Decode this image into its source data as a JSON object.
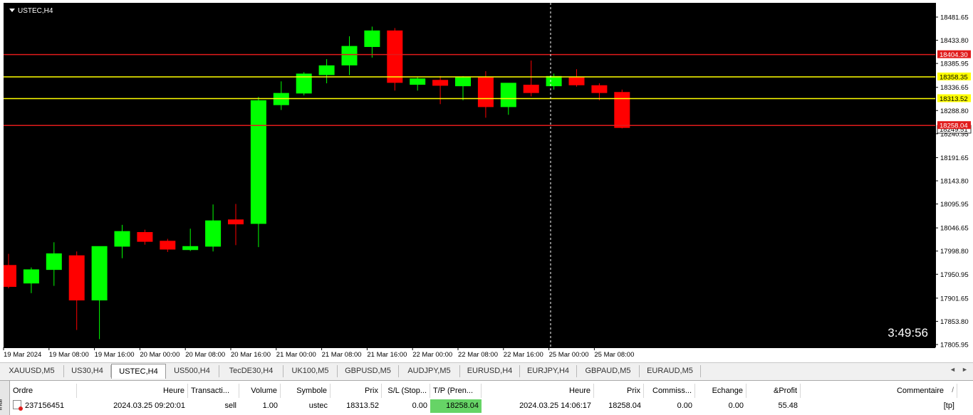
{
  "chart": {
    "symbol": "USTEC,H4",
    "countdown": "3:49:56",
    "background": "#000000",
    "bull_color": "#00ff00",
    "bear_color": "#ff0000",
    "price_ticks": [
      "18481.65",
      "18433.80",
      "18385.95",
      "18336.65",
      "18288.80",
      "18240.95",
      "18191.65",
      "18143.80",
      "18095.95",
      "18046.65",
      "17998.80",
      "17950.95",
      "17901.65",
      "17853.80",
      "17805.95"
    ],
    "time_ticks": [
      "19 Mar 2024",
      "19 Mar 08:00",
      "19 Mar 16:00",
      "20 Mar 00:00",
      "20 Mar 08:00",
      "20 Mar 16:00",
      "21 Mar 00:00",
      "21 Mar 08:00",
      "21 Mar 16:00",
      "22 Mar 00:00",
      "22 Mar 08:00",
      "22 Mar 16:00",
      "25 Mar 00:00",
      "25 Mar 08:00"
    ],
    "hlines": [
      {
        "price": 18404.3,
        "label": "18404.30",
        "color": "#e11b1b",
        "text_color": "#ffffff"
      },
      {
        "price": 18358.35,
        "label": "18358.35",
        "color": "#ffff00",
        "text_color": "#000000"
      },
      {
        "price": 18313.52,
        "label": "18313.52",
        "color": "#ffff00",
        "text_color": "#000000"
      },
      {
        "price": 18258.04,
        "label": "18258.04",
        "color": "#e11b1b",
        "text_color": "#ffffff"
      }
    ],
    "current_price": "18249.51",
    "candles": [
      {
        "o": 17970,
        "h": 17993,
        "l": 17922,
        "c": 17925
      },
      {
        "o": 17932,
        "h": 17965,
        "l": 17912,
        "c": 17961
      },
      {
        "o": 17960,
        "h": 18017,
        "l": 17927,
        "c": 17994
      },
      {
        "o": 17990,
        "h": 17998,
        "l": 17836,
        "c": 17897
      },
      {
        "o": 17897,
        "h": 18001,
        "l": 17817,
        "c": 18009
      },
      {
        "o": 18008,
        "h": 18053,
        "l": 17984,
        "c": 18040
      },
      {
        "o": 18038,
        "h": 18043,
        "l": 18012,
        "c": 18018
      },
      {
        "o": 18020,
        "h": 18024,
        "l": 17997,
        "c": 18002
      },
      {
        "o": 18001,
        "h": 18045,
        "l": 17999,
        "c": 18009
      },
      {
        "o": 18008,
        "h": 18095,
        "l": 17998,
        "c": 18062
      },
      {
        "o": 18064,
        "h": 18096,
        "l": 18011,
        "c": 18054
      },
      {
        "o": 18055,
        "h": 18317,
        "l": 18007,
        "c": 18310
      },
      {
        "o": 18300,
        "h": 18349,
        "l": 18290,
        "c": 18325
      },
      {
        "o": 18324,
        "h": 18368,
        "l": 18320,
        "c": 18365
      },
      {
        "o": 18362,
        "h": 18395,
        "l": 18345,
        "c": 18382
      },
      {
        "o": 18382,
        "h": 18442,
        "l": 18362,
        "c": 18422
      },
      {
        "o": 18420,
        "h": 18462,
        "l": 18398,
        "c": 18454
      },
      {
        "o": 18454,
        "h": 18459,
        "l": 18330,
        "c": 18346
      },
      {
        "o": 18342,
        "h": 18358,
        "l": 18330,
        "c": 18355
      },
      {
        "o": 18352,
        "h": 18360,
        "l": 18302,
        "c": 18340
      },
      {
        "o": 18339,
        "h": 18360,
        "l": 18310,
        "c": 18358
      },
      {
        "o": 18358,
        "h": 18370,
        "l": 18274,
        "c": 18296
      },
      {
        "o": 18296,
        "h": 18344,
        "l": 18280,
        "c": 18346
      },
      {
        "o": 18342,
        "h": 18392,
        "l": 18318,
        "c": 18325
      },
      {
        "o": 18339,
        "h": 18365,
        "l": 18332,
        "c": 18360
      },
      {
        "o": 18359,
        "h": 18374,
        "l": 18338,
        "c": 18341
      },
      {
        "o": 18341,
        "h": 18345,
        "l": 18310,
        "c": 18325
      },
      {
        "o": 18327,
        "h": 18332,
        "l": 18252,
        "c": 18253
      }
    ]
  },
  "tabs": [
    "XAUUSD,M5",
    "US30,H4",
    "USTEC,H4",
    "US500,H4",
    "TecDE30,H4",
    "UK100,M5",
    "GBPUSD,M5",
    "AUDJPY,M5",
    "EURUSD,H4",
    "EURJPY,H4",
    "GBPAUD,M5",
    "EURAUD,M5"
  ],
  "active_tab": "USTEC,H4",
  "terminal": {
    "side_label": "inal",
    "columns": [
      "Ordre",
      "Heure",
      "Transacti...",
      "Volume",
      "Symbole",
      "Prix",
      "S/L (Stop...",
      "T/P (Pren...",
      "Heure",
      "Prix",
      "Commiss...",
      "Echange",
      "&Profit",
      "Commentaire"
    ],
    "row": [
      "237156451",
      "2024.03.25 09:20:01",
      "sell",
      "1.00",
      "ustec",
      "18313.52",
      "0.00",
      "18258.04",
      "2024.03.25 14:06:17",
      "18258.04",
      "0.00",
      "0.00",
      "55.48",
      "[tp]"
    ],
    "tp_highlight": "#66d466"
  }
}
